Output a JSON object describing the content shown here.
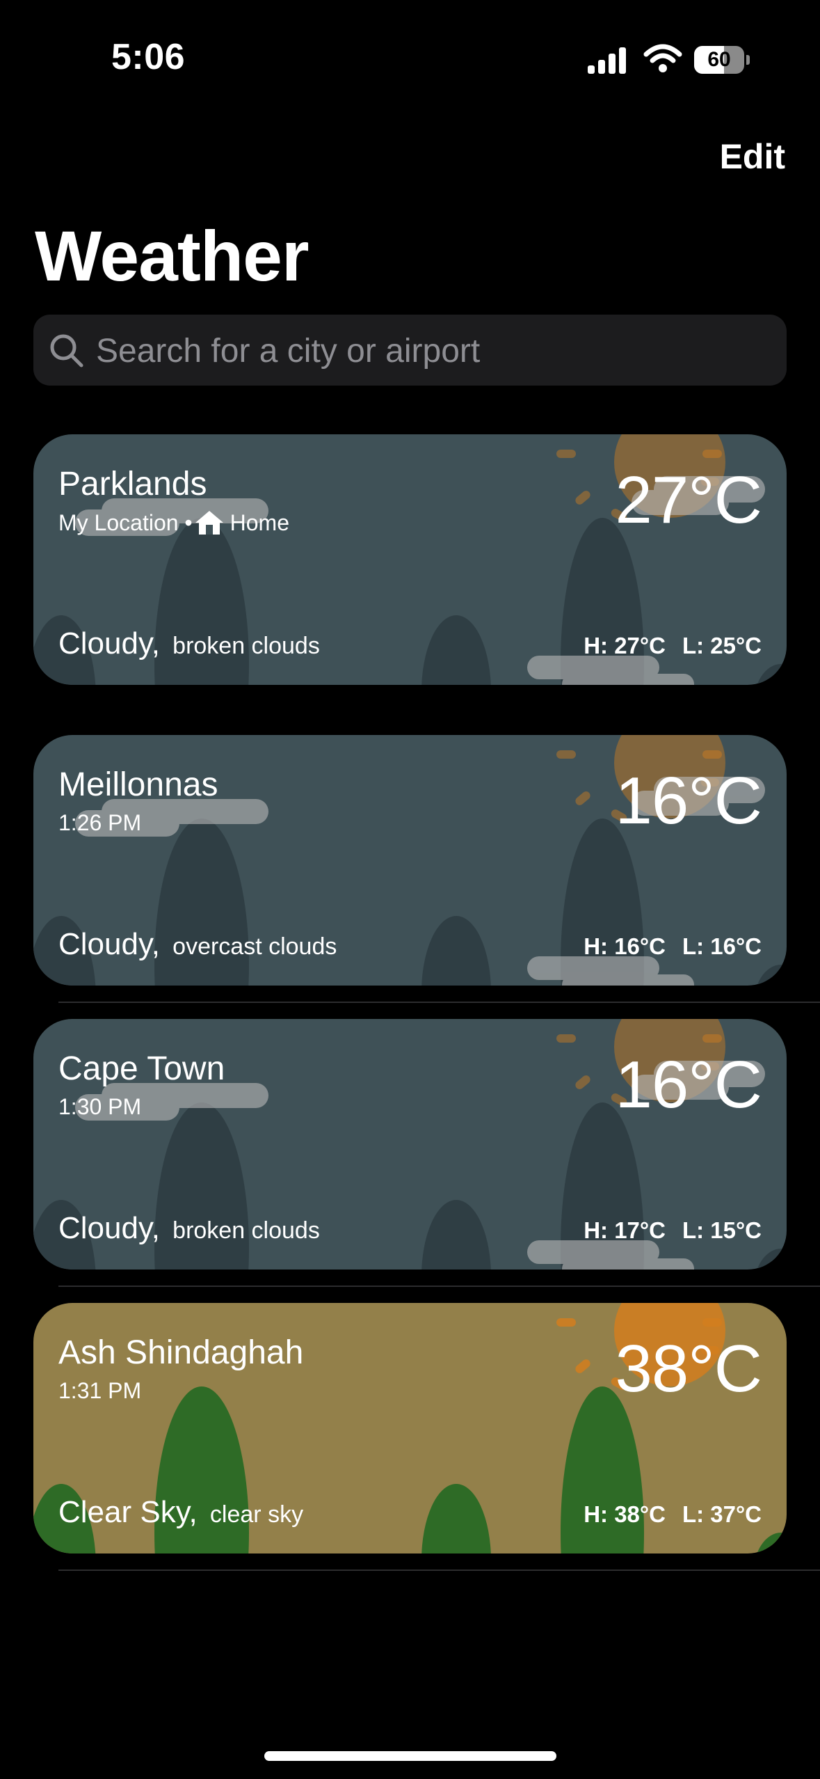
{
  "status_bar": {
    "time": "5:06",
    "battery_level": "60",
    "battery_fraction": 0.6
  },
  "header": {
    "edit_label": "Edit",
    "title": "Weather"
  },
  "search": {
    "placeholder": "Search for a city or airport",
    "icon": "search-icon"
  },
  "colors": {
    "cloudy_card": "#3f5157",
    "clear_card": "#93804a",
    "hill_cloudy": "#2f3e44",
    "hill_clear": "#2e6b26",
    "sun": "#d27e1e"
  },
  "locations": [
    {
      "city": "Parklands",
      "subtitle": "My Location •",
      "home_label": "Home",
      "temp": "27°C",
      "condition": "Cloudy,",
      "condition_detail": "broken clouds",
      "high": "H: 27°C",
      "low": "L: 25°C",
      "theme": "cloudy"
    },
    {
      "city": "Meillonnas",
      "subtitle": "1:26 PM",
      "temp": "16°C",
      "condition": "Cloudy,",
      "condition_detail": "overcast clouds",
      "high": "H: 16°C",
      "low": "L: 16°C",
      "theme": "cloudy"
    },
    {
      "city": "Cape Town",
      "subtitle": "1:30 PM",
      "temp": "16°C",
      "condition": "Cloudy,",
      "condition_detail": "broken clouds",
      "high": "H: 17°C",
      "low": "L: 15°C",
      "theme": "cloudy"
    },
    {
      "city": "Ash Shindaghah",
      "subtitle": "1:31 PM",
      "temp": "38°C",
      "condition": "Clear Sky,",
      "condition_detail": "clear sky",
      "high": "H: 38°C",
      "low": "L: 37°C",
      "theme": "clear"
    }
  ]
}
